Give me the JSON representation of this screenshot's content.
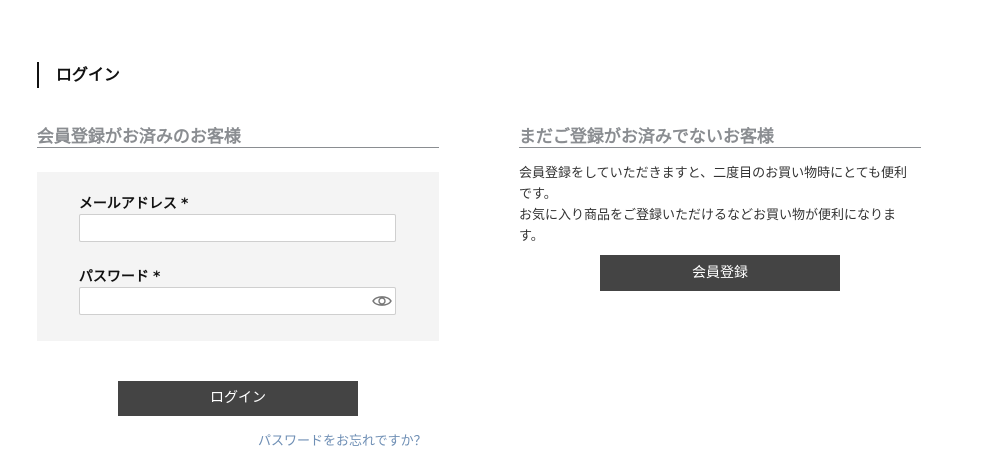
{
  "page": {
    "heading": "ログイン"
  },
  "member_login": {
    "title": "会員登録がお済みのお客様",
    "email_label": "メールアドレス",
    "email_required": "*",
    "email_value": "",
    "password_label": "パスワード",
    "password_required": "*",
    "password_value": "",
    "login_button": "ログイン",
    "forgot_link": "パスワードをお忘れですか？"
  },
  "new_customer": {
    "title": "まだご登録がお済みでないお客様",
    "description_1": "会員登録をしていただきますと、二度目のお買い物時にとても便利です。",
    "description_2": "お気に入り商品をご登録いただけるなどお買い物が便利になります。",
    "register_button": "会員登録"
  },
  "icons": {
    "password_toggle": "eye-icon"
  },
  "colors": {
    "button_bg": "#444444",
    "section_title": "#8a8d91",
    "form_bg": "#f4f4f4",
    "link": "#6f8fb5"
  }
}
